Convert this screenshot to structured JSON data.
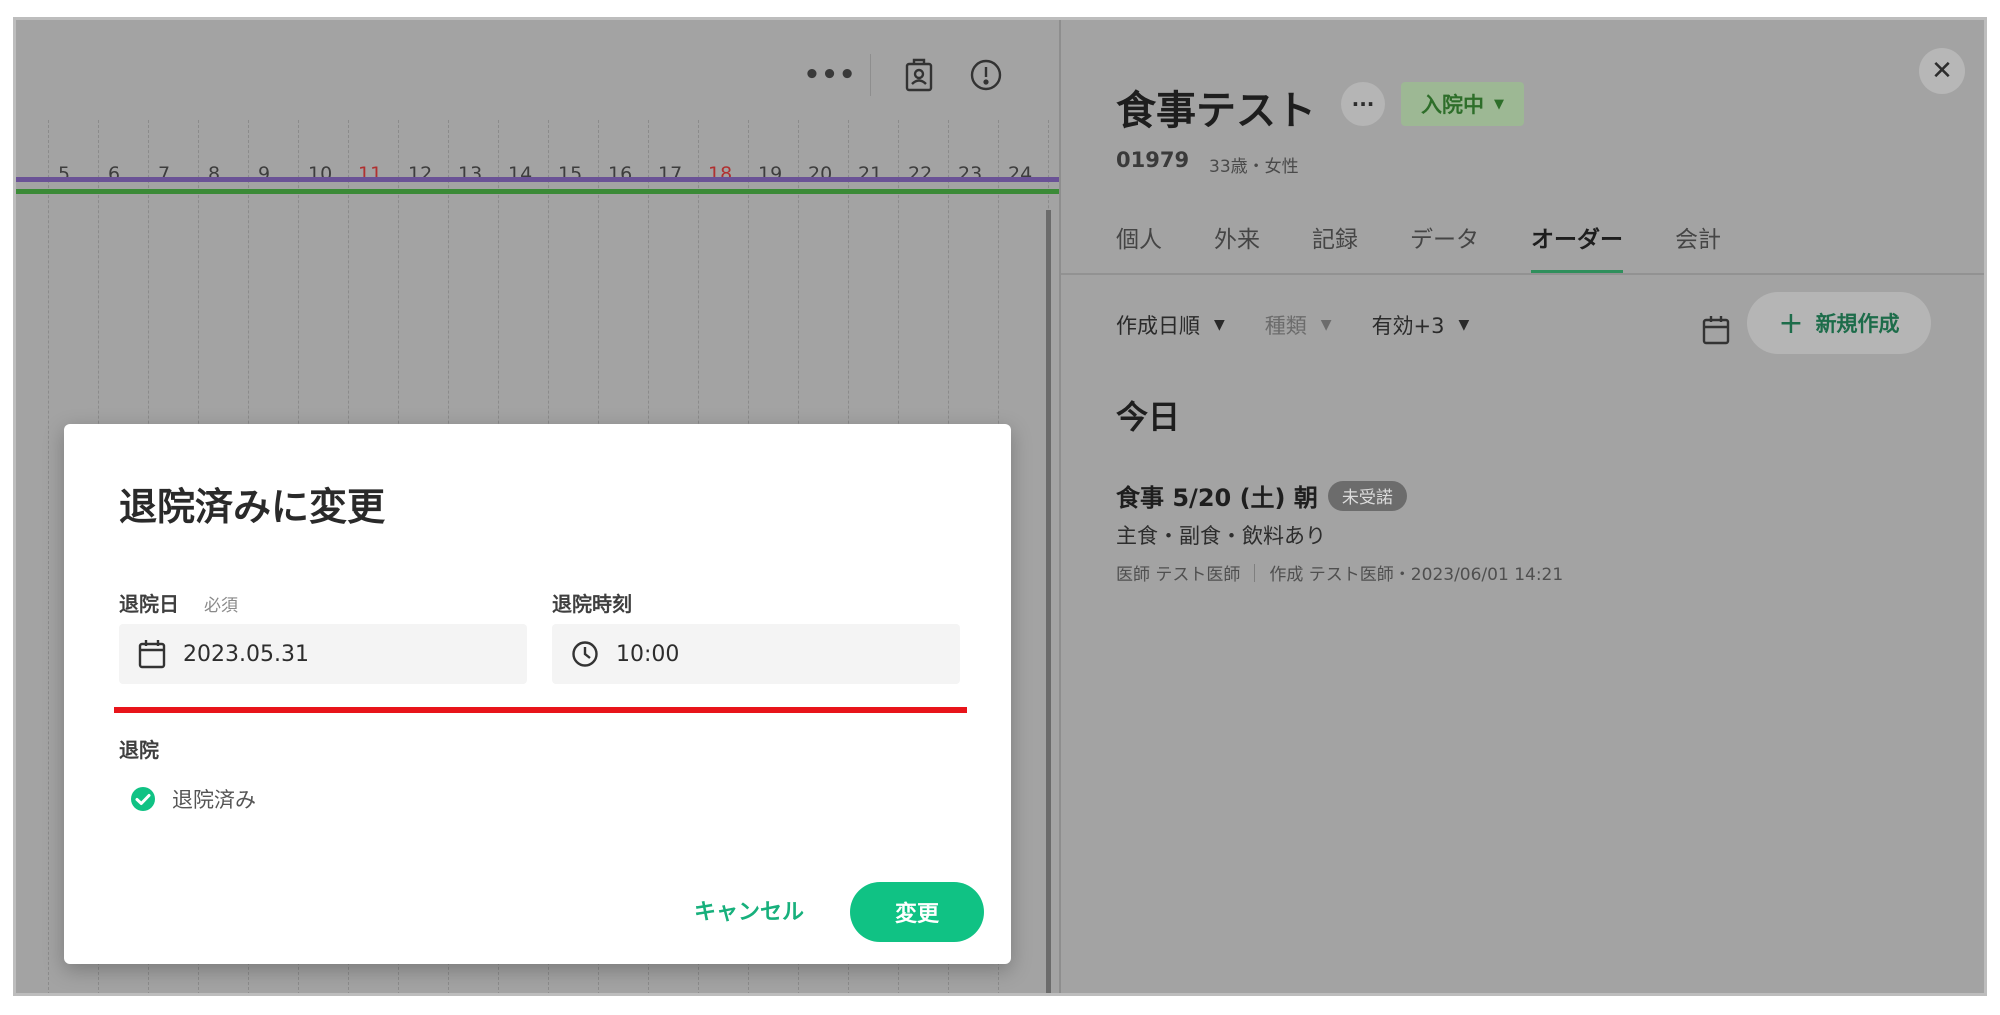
{
  "timeline": {
    "days": [
      {
        "label": "5",
        "weekend": false
      },
      {
        "label": "6",
        "weekend": false
      },
      {
        "label": "7",
        "weekend": false
      },
      {
        "label": "8",
        "weekend": false
      },
      {
        "label": "9",
        "weekend": false
      },
      {
        "label": "10",
        "weekend": false
      },
      {
        "label": "11",
        "weekend": true
      },
      {
        "label": "12",
        "weekend": false
      },
      {
        "label": "13",
        "weekend": false
      },
      {
        "label": "14",
        "weekend": false
      },
      {
        "label": "15",
        "weekend": false
      },
      {
        "label": "16",
        "weekend": false
      },
      {
        "label": "17",
        "weekend": false
      },
      {
        "label": "18",
        "weekend": true
      },
      {
        "label": "19",
        "weekend": false
      },
      {
        "label": "20",
        "weekend": false
      },
      {
        "label": "21",
        "weekend": false
      },
      {
        "label": "22",
        "weekend": false
      },
      {
        "label": "23",
        "weekend": false
      },
      {
        "label": "24",
        "weekend": false
      }
    ],
    "toolbar": {
      "more_icon": "more-horizontal-icon",
      "badge_icon": "id-badge-icon",
      "alert_icon": "alert-circle-icon"
    },
    "colors": {
      "purple_bar": "#6a5296",
      "green_bar": "#3b8a37",
      "weekend_text": "#b03030"
    }
  },
  "patient": {
    "name": "食事テスト",
    "more": "···",
    "status": "入院中",
    "id": "01979",
    "meta": "33歳・女性"
  },
  "tabs": [
    {
      "label": "個人",
      "active": false
    },
    {
      "label": "外来",
      "active": false
    },
    {
      "label": "記録",
      "active": false
    },
    {
      "label": "データ",
      "active": false
    },
    {
      "label": "オーダー",
      "active": true
    },
    {
      "label": "会計",
      "active": false
    }
  ],
  "filters": {
    "sort": "作成日順",
    "type": "種類",
    "validity": "有効+3"
  },
  "new_button": {
    "plus": "+",
    "label": "新規作成"
  },
  "orders": {
    "section_title": "今日",
    "item": {
      "title": "食事 5/20 (土) 朝",
      "badge": "未受諾",
      "detail": "主食・副食・飲料あり",
      "doctor": "医師 テスト医師",
      "created": "作成 テスト医師・2023/06/01 14:21"
    }
  },
  "modal": {
    "title": "退院済みに変更",
    "date_label": "退院日",
    "required": "必須",
    "date_value": "2023.05.31",
    "time_label": "退院時刻",
    "time_value": "10:00",
    "discharge_label": "退院",
    "discharge_option": "退院済み",
    "cancel": "キャンセル",
    "confirm": "変更",
    "colors": {
      "accent": "#10c284",
      "underline": "#e8141a"
    }
  }
}
